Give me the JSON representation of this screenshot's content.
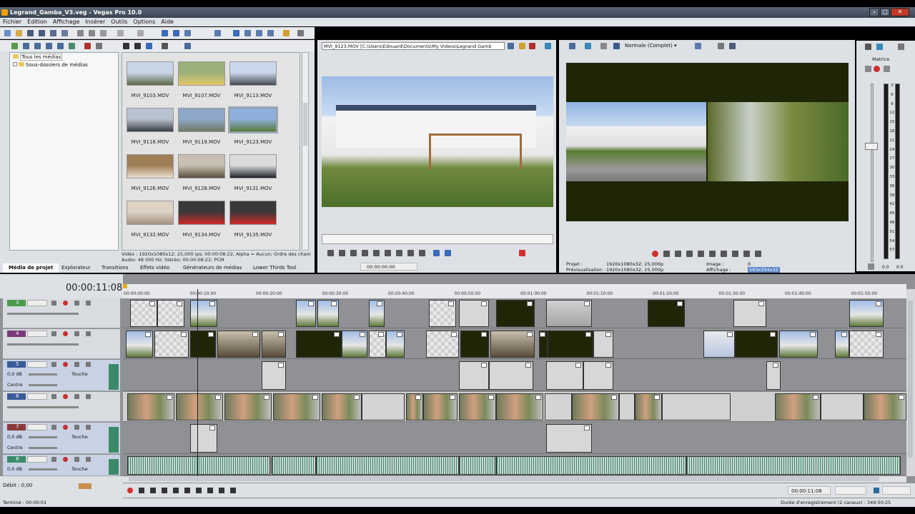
{
  "window": {
    "title": "Legrand_Gamba_V3.veg - Vegas Pro 10.0"
  },
  "menu": [
    "Fichier",
    "Edition",
    "Affichage",
    "Insérer",
    "Outils",
    "Options",
    "Aide"
  ],
  "explorer": {
    "items": [
      "Tous les médias",
      "Sous-dossiers de médias"
    ]
  },
  "media": [
    {
      "name": "MVI_9103.MOV",
      "c1": "#c9d6e8",
      "c2": "#5d6a4a"
    },
    {
      "name": "MVI_9107.MOV",
      "c1": "#9bb07a",
      "c2": "#e3c868"
    },
    {
      "name": "MVI_9113.MOV",
      "c1": "#c9d8ea",
      "c2": "#454b53"
    },
    {
      "name": "MVI_9116.MOV",
      "c1": "#b9c3cf",
      "c2": "#3a3f45"
    },
    {
      "name": "MVI_9119.MOV",
      "c1": "#8fa7c9",
      "c2": "#6f7a66"
    },
    {
      "name": "MVI_9123.MOV",
      "c1": "#8fb0de",
      "c2": "#557a3a"
    },
    {
      "name": "MVI_9126.MOV",
      "c1": "#9f7e56",
      "c2": "#e8e0d0"
    },
    {
      "name": "MVI_9128.MOV",
      "c1": "#c8c1b3",
      "c2": "#5c4e3d"
    },
    {
      "name": "MVI_9131.MOV",
      "c1": "#dcdcdc",
      "c2": "#1f232a"
    },
    {
      "name": "MVI_9132.MOV",
      "c1": "#ddd2c4",
      "c2": "#a59380"
    },
    {
      "name": "MVI_9134.MOV",
      "c1": "#3a3a3a",
      "c2": "#cc2a2a"
    },
    {
      "name": "MVI_9135.MOV",
      "c1": "#3a3a3a",
      "c2": "#cc2a2a"
    }
  ],
  "media_info": {
    "line1": "Vidéo : 1920x1080x12; 25,000 ips; 00:00:08:22; Alpha = Aucun; Ordre des cham",
    "line2": "Audio: 48 000 Hz; Stéréo; 00:00:08:22; PCM"
  },
  "tabs": [
    "Média de projet",
    "Explorateur",
    "Transitions",
    "Effets vidéo",
    "Générateurs de médias",
    "Lower Thirds Tool"
  ],
  "trimmer": {
    "path": "MVI_9123.MOV    [C:\\Users\\Edouard\\Documents\\My Videos\\Legrand Gamb",
    "time": "00:00:00:00"
  },
  "preview": {
    "quality": "Normale (Complet)",
    "projet_label": "Projet :",
    "projet_val": "1920x1080x32; 25,000p",
    "previs_label": "Prévisualisation :",
    "previs_val": "1920x1080x32; 25,000p",
    "image_label": "Image :",
    "image_val": "0",
    "affichage_label": "Affichage :",
    "affichage_val": "593x334x32"
  },
  "meter": {
    "label": "Matrice",
    "scale": [
      "3",
      "6",
      "9",
      "12",
      "15",
      "18",
      "21",
      "24",
      "27",
      "30",
      "33",
      "36",
      "39",
      "42",
      "45",
      "48",
      "51",
      "54",
      "57"
    ],
    "left": "0.0",
    "right": "0.0"
  },
  "timeline": {
    "timecode": "00:00:11:08",
    "ruler": [
      "00:00:00:00",
      "00:00:10:00",
      "00:00:20:00",
      "00:00:30:00",
      "00:00:40:00",
      "00:00:50:00",
      "00:01:00:00",
      "00:01:10:00",
      "00:01:20:00",
      "00:01:30:00",
      "00:01:40:00",
      "00:01:50:00"
    ]
  },
  "tracks": [
    {
      "num": "3",
      "color": "#4a9a4a"
    },
    {
      "num": "4",
      "color": "#7a3a7a"
    },
    {
      "num": "5",
      "color": "#3a5a9a",
      "db": "0,0 dB",
      "mode": "Touche",
      "pan": "Centre"
    },
    {
      "num": "6",
      "color": "#3a5a9a"
    },
    {
      "num": "7",
      "color": "#8a3a3a",
      "db": "0,0 dB",
      "mode": "Touche",
      "pan": "Centre"
    },
    {
      "num": "8",
      "color": "#3a8a6a",
      "db": "0,0 dB",
      "mode": "Touche"
    }
  ],
  "debit": "Débit : 0,00",
  "transport_time": "00:00:11:08",
  "status": {
    "left": "Terminé : 00:00:01",
    "right": "Durée d'enregistrement (2 canaux) : 349:50:25"
  },
  "colors": {
    "titlebar": "#4a5564",
    "panel": "#dde0e5",
    "timeline_bg": "#8f9194",
    "audio_wave": "#2f8a6a"
  }
}
